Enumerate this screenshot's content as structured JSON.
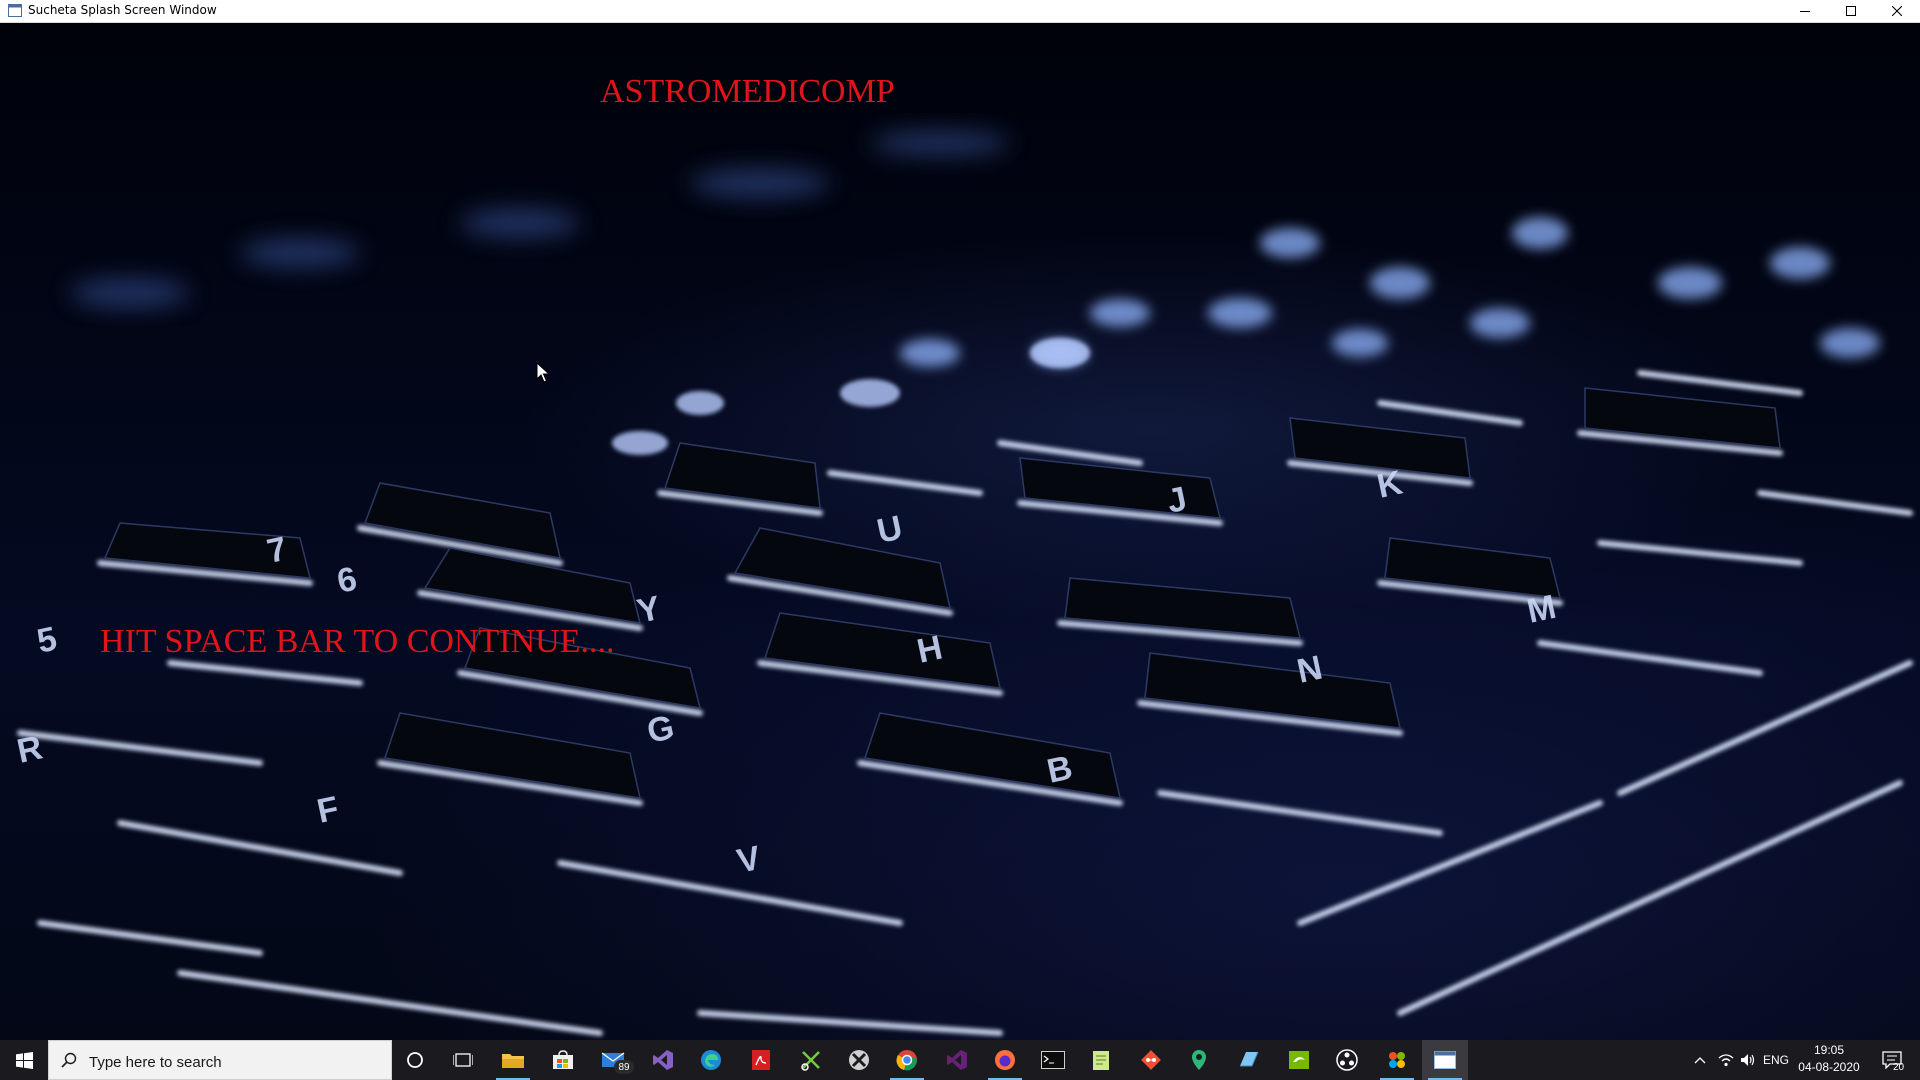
{
  "window": {
    "title": "Sucheta Splash Screen Window"
  },
  "splash": {
    "heading": "ASTROMEDICOMP",
    "prompt": "HIT SPACE BAR TO CONTINUE....",
    "text_color": "#e0141a"
  },
  "taskbar": {
    "search_placeholder": "Type here to search",
    "mail_badge": "89",
    "pinned_icons": [
      "cortana-icon",
      "task-view-icon",
      "file-explorer-icon",
      "store-icon",
      "mail-icon",
      "visual-studio-icon",
      "edge-icon",
      "acrobat-icon",
      "snipping-tool-icon",
      "xbox-icon",
      "chrome-icon",
      "visual-studio-2-icon",
      "firefox-icon",
      "terminal-icon",
      "notepad-icon",
      "git-icon",
      "maps-icon",
      "paint-icon",
      "nvidia-icon",
      "obs-icon",
      "paint-3d-icon",
      "active-window-icon"
    ],
    "language": "ENG",
    "time": "19:05",
    "date": "04-08-2020",
    "notification_count": "20",
    "accent": "#76b9ed"
  }
}
